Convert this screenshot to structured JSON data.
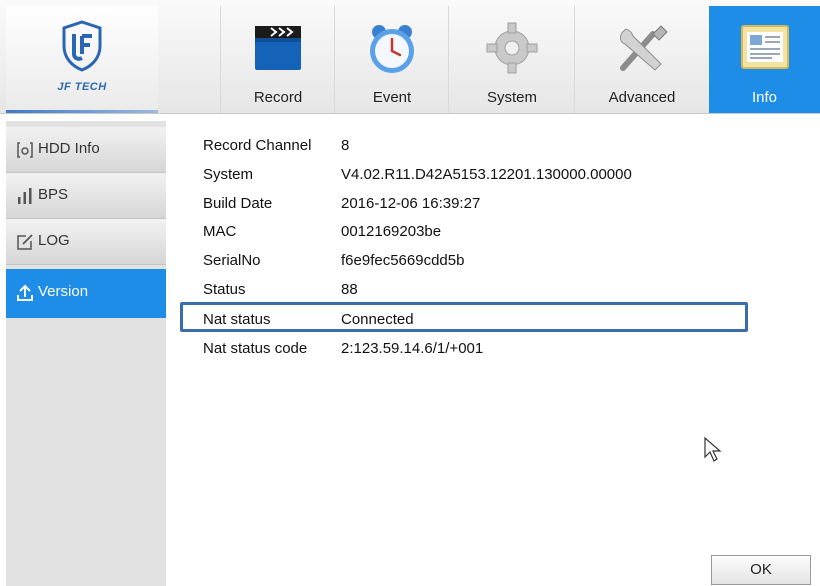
{
  "brand": {
    "logo_text": "JF TECH"
  },
  "nav": {
    "tabs": [
      {
        "label": "Record"
      },
      {
        "label": "Event"
      },
      {
        "label": "System"
      },
      {
        "label": "Advanced"
      },
      {
        "label": "Info",
        "active": true
      }
    ]
  },
  "sidebar": {
    "items": [
      {
        "label": "HDD Info"
      },
      {
        "label": "BPS"
      },
      {
        "label": "LOG"
      },
      {
        "label": "Version",
        "active": true
      }
    ]
  },
  "version_info": {
    "rows": [
      {
        "key": "Record Channel",
        "value": "8"
      },
      {
        "key": "System",
        "value": "V4.02.R11.D42A5153.12201.130000.00000"
      },
      {
        "key": "Build Date",
        "value": "2016-12-06 16:39:27"
      },
      {
        "key": "MAC",
        "value": "0012169203be"
      },
      {
        "key": "SerialNo",
        "value": "f6e9fec5669cdd5b"
      },
      {
        "key": "Status",
        "value": "88"
      },
      {
        "key": "Nat status",
        "value": "Connected"
      },
      {
        "key": "Nat status code",
        "value": "2:123.59.14.6/1/+001"
      }
    ]
  },
  "footer": {
    "ok_label": "OK"
  },
  "colors": {
    "accent": "#1e8de8",
    "highlight_border": "#3a6dab"
  }
}
